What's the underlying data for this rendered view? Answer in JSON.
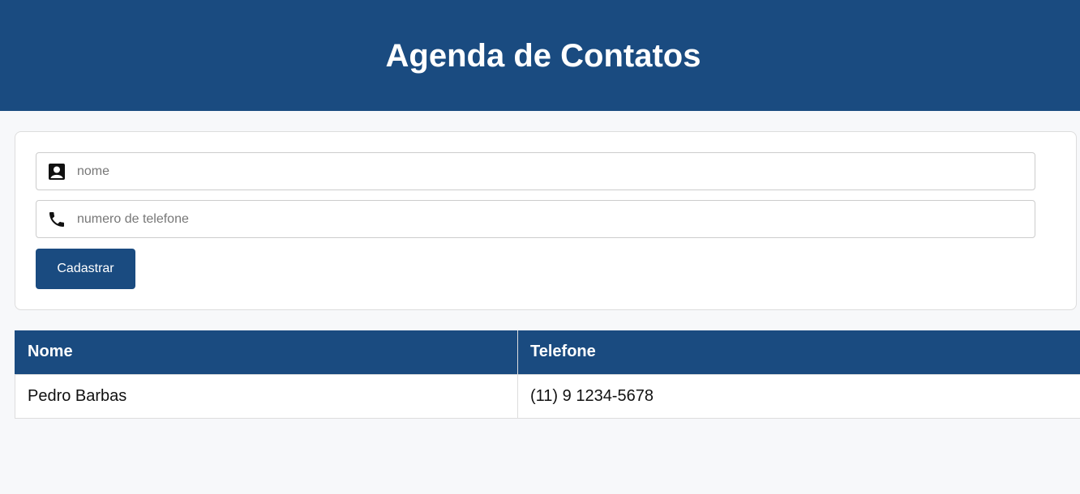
{
  "header": {
    "title": "Agenda de Contatos"
  },
  "form": {
    "name_placeholder": "nome",
    "name_value": "",
    "phone_placeholder": "numero de telefone",
    "phone_value": "",
    "submit_label": "Cadastrar",
    "name_icon": "contact-person-icon",
    "phone_icon": "phone-icon"
  },
  "table": {
    "columns": [
      "Nome",
      "Telefone"
    ],
    "rows": [
      {
        "nome": "Pedro Barbas",
        "telefone": "(11) 9 1234-5678"
      }
    ]
  },
  "colors": {
    "primary": "#1a4b80",
    "background": "#f7f8fa",
    "border": "#dddddd"
  }
}
